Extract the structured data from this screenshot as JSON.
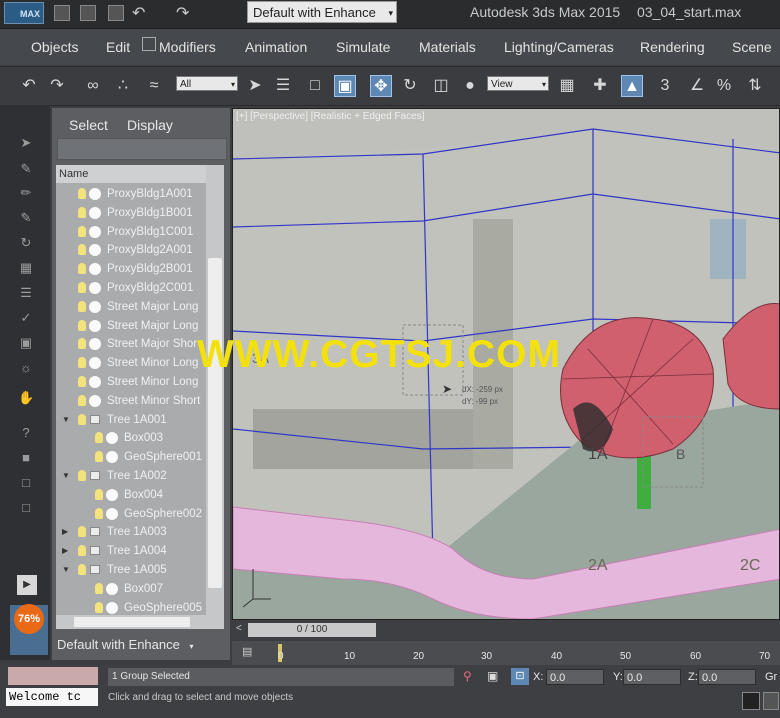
{
  "titlebar": {
    "logo_text": "MAX",
    "workspace": "Default with Enhance",
    "app_title": "Autodesk 3ds Max  2015",
    "file_name": "03_04_start.max"
  },
  "menu": [
    "Objects",
    "Edit",
    "Modifiers",
    "Animation",
    "Simulate",
    "Materials",
    "Lighting/Cameras",
    "Rendering",
    "Scene"
  ],
  "toolbar": {
    "selection_filter": "All",
    "reference_coord": "View",
    "snap_label": "3",
    "percent_label": "%"
  },
  "explorer": {
    "tabs": [
      "Select",
      "Display"
    ],
    "column_header": "Name",
    "rows": [
      {
        "label": "ProxyBldg1A001",
        "depth": 0
      },
      {
        "label": "ProxyBldg1B001",
        "depth": 0
      },
      {
        "label": "ProxyBldg1C001",
        "depth": 0
      },
      {
        "label": "ProxyBldg2A001",
        "depth": 0
      },
      {
        "label": "ProxyBldg2B001",
        "depth": 0
      },
      {
        "label": "ProxyBldg2C001",
        "depth": 0
      },
      {
        "label": "Street Major Long",
        "depth": 0
      },
      {
        "label": "Street Major Long",
        "depth": 0
      },
      {
        "label": "Street Major Shor",
        "depth": 0
      },
      {
        "label": "Street Minor Long",
        "depth": 0
      },
      {
        "label": "Street Minor Long",
        "depth": 0
      },
      {
        "label": "Street Minor Short",
        "depth": 0
      },
      {
        "label": "Tree 1A001",
        "depth": 0,
        "group": "expanded"
      },
      {
        "label": "Box003",
        "depth": 1
      },
      {
        "label": "GeoSphere001",
        "depth": 1
      },
      {
        "label": "Tree 1A002",
        "depth": 0,
        "group": "expanded"
      },
      {
        "label": "Box004",
        "depth": 1
      },
      {
        "label": "GeoSphere002",
        "depth": 1
      },
      {
        "label": "Tree 1A003",
        "depth": 0,
        "group": "collapsed"
      },
      {
        "label": "Tree 1A004",
        "depth": 0,
        "group": "collapsed"
      },
      {
        "label": "Tree 1A005",
        "depth": 0,
        "group": "expanded"
      },
      {
        "label": "Box007",
        "depth": 1
      },
      {
        "label": "GeoSphere005",
        "depth": 1
      }
    ],
    "layer_dropdown": "Default with Enhance"
  },
  "viewport": {
    "label": "[+] [Perspective] [Realistic + Edged Faces]",
    "labels_3d": [
      "3A",
      "1A",
      "B",
      "2A",
      "2C"
    ],
    "drag_dx": "dX: -259 px",
    "drag_dy": "dY: -99 px",
    "watermark": "WWW.CGTSJ.COM"
  },
  "timeline": {
    "counter": "0 / 100",
    "ticks": [
      "0",
      "10",
      "20",
      "30",
      "40",
      "50",
      "60",
      "70"
    ]
  },
  "status": {
    "maxscript": "Welcome tc",
    "selection": "1 Group Selected",
    "prompt": "Click and drag to select and move objects",
    "x_label": "X:",
    "x_value": "0.0",
    "y_label": "Y:",
    "y_value": "0.0",
    "z_label": "Z:",
    "z_value": "0.0",
    "grid_label": "Gr",
    "badge": "76%"
  },
  "colors": {
    "tree_foliage": "#d0606e",
    "tree_trunk": "#3fae3f",
    "sidewalk": "#e6b7dc",
    "active_tool": "#5e87b3",
    "watermark": "#f5e10a"
  }
}
